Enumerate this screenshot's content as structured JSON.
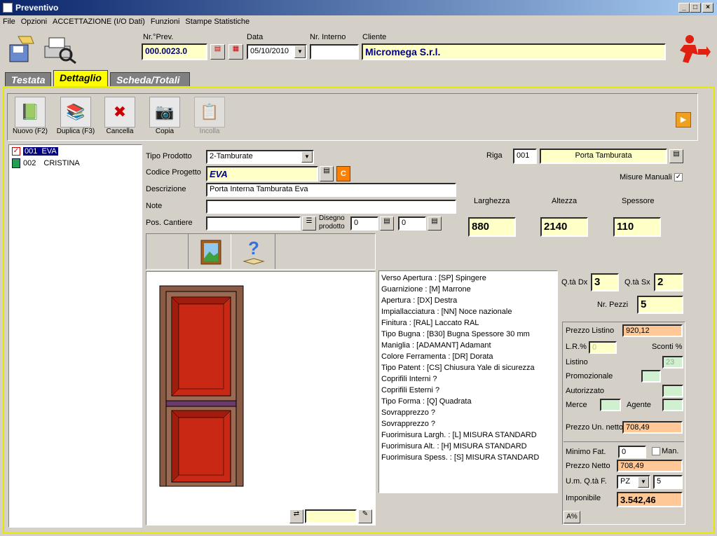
{
  "window": {
    "title": "Preventivo"
  },
  "menu": [
    "File",
    "Opzioni",
    "ACCETTAZIONE (I/O Dati)",
    "Funzioni",
    "Stampe Statistiche"
  ],
  "header": {
    "nr_prev_label": "Nr.°Prev.",
    "nr_prev": "000.0023.0",
    "data_label": "Data",
    "data": "05/10/2010",
    "nr_interno_label": "Nr. Interno",
    "nr_interno": "",
    "cliente_label": "Cliente",
    "cliente": "Micromega S.r.l."
  },
  "tabs": [
    "Testata",
    "Dettaglio",
    "Scheda/Totali"
  ],
  "toolbar": {
    "nuovo": "Nuovo (F2)",
    "duplica": "Duplica (F3)",
    "cancella": "Cancella",
    "copia": "Copia",
    "incolla": "Incolla"
  },
  "tree": [
    {
      "code": "001",
      "name": "EVA"
    },
    {
      "code": "002",
      "name": "CRISTINA"
    }
  ],
  "form": {
    "tipo_prodotto_label": "Tipo Prodotto",
    "tipo_prodotto": "2-Tamburate",
    "codice_progetto_label": "Codice Progetto",
    "codice_progetto": "EVA",
    "c_button": "C",
    "descrizione_label": "Descrizione",
    "descrizione": "Porta Interna Tamburata Eva",
    "note_label": "Note",
    "note": "",
    "pos_cantiere_label": "Pos. Cantiere",
    "pos_cantiere": "",
    "disegno_label_1": "Disegno",
    "disegno_label_2": "prodotto",
    "disegno_val1": "0",
    "disegno_val2": "0"
  },
  "riga": {
    "label": "Riga",
    "num": "001",
    "desc": "Porta Tamburata",
    "misure_label": "Misure Manuali",
    "misure_checked": "✓"
  },
  "dims": {
    "larghezza_label": "Larghezza",
    "larghezza": "880",
    "altezza_label": "Altezza",
    "altezza": "2140",
    "spessore_label": "Spessore",
    "spessore": "110"
  },
  "attributes": [
    "Verso Apertura : [SP] Spingere",
    "Guarnizione : [M] Marrone",
    "Apertura : [DX] Destra",
    "Impiallacciatura : [NN] Noce nazionale",
    "Finitura : [RAL] Laccato RAL",
    "Tipo Bugna : [B30] Bugna Spessore 30 mm",
    "Maniglia : [ADAMANT]  Adamant",
    "Colore Ferramenta : [DR] Dorata",
    "Tipo Patent : [CS] Chiusura Yale di sicurezza",
    "Coprifili Interni ?",
    "Coprifili Esterni ?",
    "Tipo Forma : [Q] Quadrata",
    "Sovrapprezzo ?",
    "Sovrapprezzo ?",
    "Fuorimisura Largh. : [L] MISURA STANDARD",
    "Fuorimisura Alt. : [H] MISURA STANDARD",
    "Fuorimisura Spess. : [S] MISURA STANDARD"
  ],
  "qty": {
    "dx_label": "Q.tà Dx",
    "dx": "3",
    "sx_label": "Q.tà Sx",
    "sx": "2",
    "pezzi_label": "Nr. Pezzi",
    "pezzi": "5"
  },
  "prices": {
    "listino_label": "Prezzo Listino",
    "listino": "920,12",
    "lr_label": "L.R.%",
    "lr": "0",
    "sconti_label": "Sconti %",
    "listino2_label": "Listino",
    "listino2": "23",
    "promo_label": "Promozionale",
    "autorizzato_label": "Autorizzato",
    "merce_label": "Merce",
    "agente_label": "Agente",
    "un_netto_label": "Prezzo Un. netto",
    "un_netto": "708,49",
    "minimo_label": "Minimo Fat.",
    "minimo": "0",
    "man_label": "Man.",
    "netto_label": "Prezzo Netto",
    "netto": "708,49",
    "um_label": "U.m. Q.tà F.",
    "um": "PZ",
    "um_qty": "5",
    "imponibile_label": "Imponibile",
    "imponibile": "3.542,46",
    "az_button": "A%"
  },
  "colors": {
    "title_start": "#0a246a",
    "yellow_field": "#ffffc8",
    "orange_field": "#ffc896",
    "door": "#c82814",
    "frame": "#8b5a44"
  }
}
